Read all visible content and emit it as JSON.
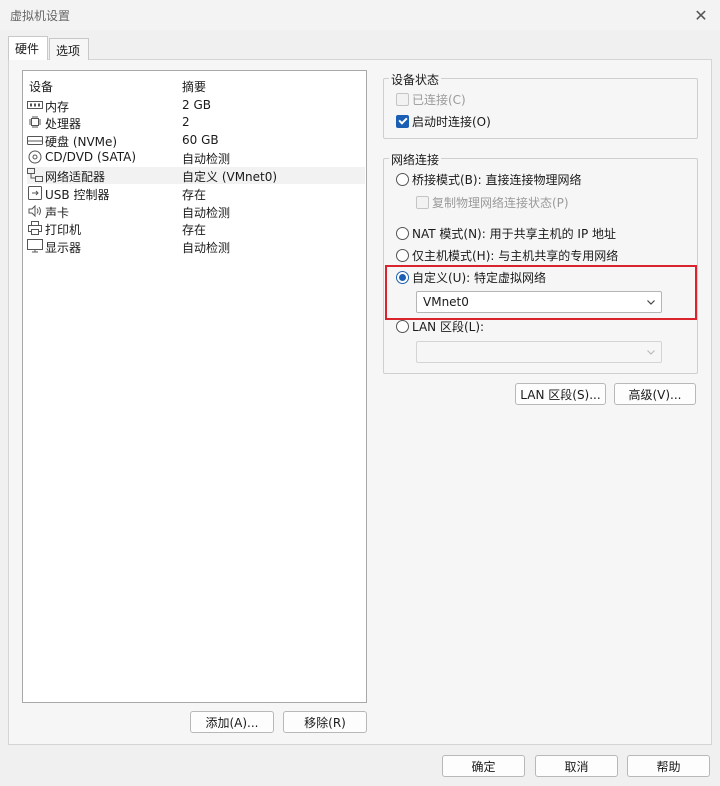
{
  "window": {
    "title": "虚拟机设置",
    "close_icon": "close-icon"
  },
  "tabs": [
    {
      "label": "硬件",
      "active": true
    },
    {
      "label": "选项",
      "active": false
    }
  ],
  "device_list": {
    "headers": {
      "device": "设备",
      "summary": "摘要"
    },
    "rows": [
      {
        "name": "内存",
        "summary": "2 GB",
        "icon": "memory-icon"
      },
      {
        "name": "处理器",
        "summary": "2",
        "icon": "cpu-icon"
      },
      {
        "name": "硬盘 (NVMe)",
        "summary": "60 GB",
        "icon": "disk-icon"
      },
      {
        "name": "CD/DVD (SATA)",
        "summary": "自动检测",
        "icon": "cd-icon"
      },
      {
        "name": "网络适配器",
        "summary": "自定义 (VMnet0)",
        "icon": "network-icon",
        "selected": true
      },
      {
        "name": "USB 控制器",
        "summary": "存在",
        "icon": "usb-icon"
      },
      {
        "name": "声卡",
        "summary": "自动检测",
        "icon": "speaker-icon"
      },
      {
        "name": "打印机",
        "summary": "存在",
        "icon": "printer-icon"
      },
      {
        "name": "显示器",
        "summary": "自动检测",
        "icon": "monitor-icon"
      }
    ],
    "add_label": "添加(A)...",
    "remove_label": "移除(R)"
  },
  "device_status": {
    "title": "设备状态",
    "connected": {
      "label": "已连接(C)",
      "checked": false,
      "enabled": false
    },
    "connect_at_power_on": {
      "label": "启动时连接(O)",
      "checked": true,
      "enabled": true
    }
  },
  "network": {
    "title": "网络连接",
    "bridged": {
      "label": "桥接模式(B): 直接连接物理网络",
      "checked": false
    },
    "replicate": {
      "label": "复制物理网络连接状态(P)",
      "checked": false,
      "enabled": false
    },
    "nat": {
      "label": "NAT 模式(N): 用于共享主机的 IP 地址",
      "checked": false
    },
    "host_only": {
      "label": "仅主机模式(H): 与主机共享的专用网络",
      "checked": false
    },
    "custom": {
      "label": "自定义(U): 特定虚拟网络",
      "checked": true
    },
    "custom_select": "VMnet0",
    "lan_segment": {
      "label": "LAN 区段(L):",
      "checked": false
    },
    "lan_select": ""
  },
  "panel_buttons": {
    "lan_segments": "LAN 区段(S)...",
    "advanced": "高级(V)..."
  },
  "footer": {
    "ok": "确定",
    "cancel": "取消",
    "help": "帮助"
  },
  "colors": {
    "accent": "#1a5fb4",
    "highlight": "#d9232d"
  }
}
